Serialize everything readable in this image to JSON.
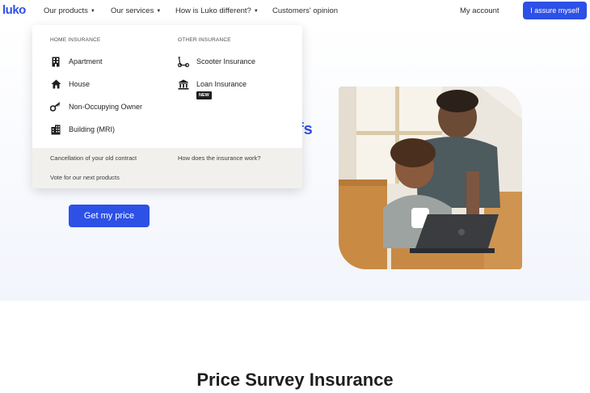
{
  "header": {
    "logo": "luko",
    "nav": [
      {
        "label": "Our products",
        "caret": "▼"
      },
      {
        "label": "Our services",
        "caret": "▼"
      },
      {
        "label": "How is Luko different?",
        "caret": "▼"
      },
      {
        "label": "Customers' opinion"
      }
    ],
    "account": "My account",
    "cta": "I assure myself"
  },
  "dropdown": {
    "home_heading": "HOME INSURANCE",
    "home_items": [
      {
        "label": "Apartment",
        "icon": "building-icon"
      },
      {
        "label": "House",
        "icon": "house-icon"
      },
      {
        "label": "Non-Occupying Owner",
        "icon": "key-icon"
      },
      {
        "label": "Building (MRI)",
        "icon": "apartment-building-icon"
      }
    ],
    "other_heading": "OTHER INSURANCE",
    "other_items": [
      {
        "label": "Scooter Insurance",
        "icon": "scooter-icon"
      },
      {
        "label": "Loan Insurance",
        "icon": "bank-icon",
        "badge": "NEW"
      }
    ],
    "footer_links": [
      "Cancellation of your old contract",
      "How does the insurance work?",
      "Vote for our next products"
    ]
  },
  "hero": {
    "headline_fragment": "fs",
    "button": "Get my price"
  },
  "section_title": "Price Survey Insurance",
  "colors": {
    "brand": "#2d50e6",
    "footer_bg": "#f1f0ec",
    "text": "#1e1f1d"
  }
}
